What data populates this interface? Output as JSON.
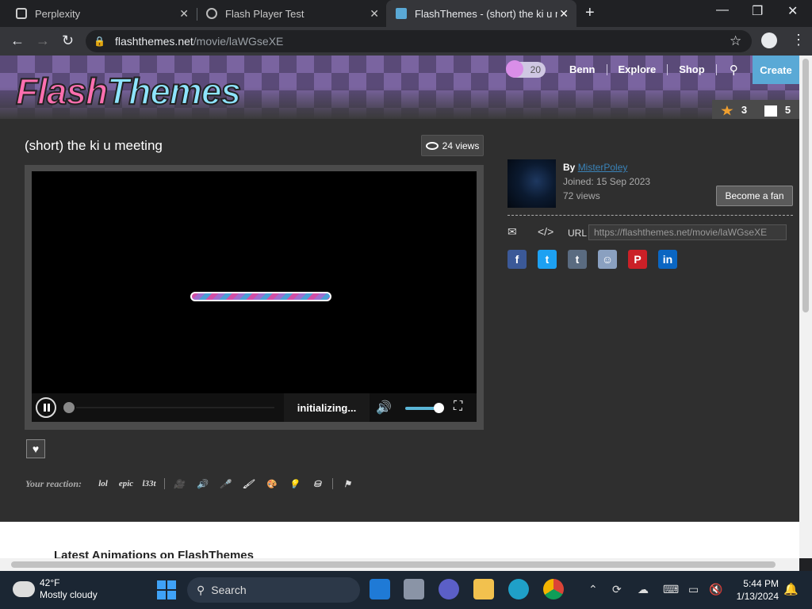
{
  "browser": {
    "tabs": [
      {
        "title": "Perplexity",
        "active": false
      },
      {
        "title": "Flash Player Test",
        "active": false
      },
      {
        "title": "FlashThemes - (short) the ki u meeting",
        "active": true
      }
    ],
    "url_host": "flashthemes.net",
    "url_path": "/movie/laWGseXE"
  },
  "site": {
    "logo_part1": "Flash",
    "logo_part2": "Themes",
    "coins": "20",
    "nav": [
      "Benn",
      "Explore",
      "Shop"
    ],
    "create_label": "Create",
    "counter_badges": "3",
    "counter_messages": "5"
  },
  "movie": {
    "title": "(short) the ki u meeting",
    "views_label": "24 views",
    "player_status": "initializing...",
    "progress": 0,
    "volume": 0.8
  },
  "author": {
    "by_label": "By",
    "name": "MisterPoley",
    "joined": "Joined: 15 Sep 2023",
    "views": "72 views",
    "info_link": "",
    "fan_button": "Become a fan"
  },
  "share": {
    "url_label": "URL",
    "url_value": "https://flashthemes.net/movie/laWGseXE",
    "networks": [
      "facebook",
      "twitter",
      "tumblr",
      "reddit",
      "pinterest",
      "linkedin"
    ]
  },
  "reactions": {
    "label": "Your reaction:",
    "items": [
      "lol",
      "epic",
      "l33t"
    ]
  },
  "below": {
    "latest_title": "Latest Animations on FlashThemes",
    "prev": "",
    "page": "",
    "next": "",
    "recommended": ""
  },
  "taskbar": {
    "temperature": "42°F",
    "weather": "Mostly cloudy",
    "search_label": "Search",
    "time": "5:44 PM",
    "date": "1/13/2024"
  }
}
